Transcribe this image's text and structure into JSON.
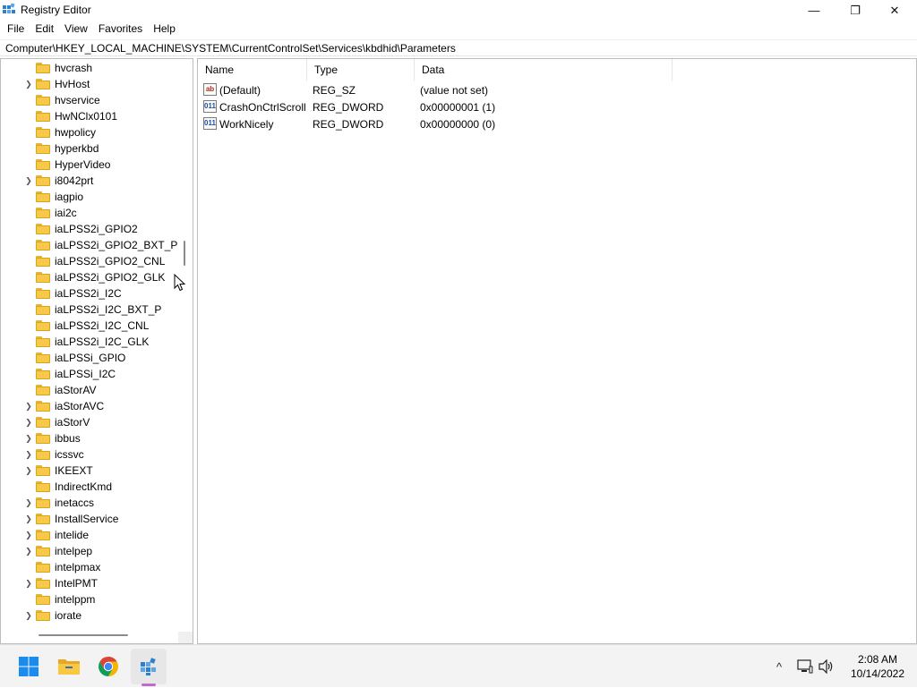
{
  "window": {
    "title": "Registry Editor",
    "minimize_glyph": "—",
    "maximize_glyph": "❐",
    "close_glyph": "✕"
  },
  "menu": [
    "File",
    "Edit",
    "View",
    "Favorites",
    "Help"
  ],
  "address": "Computer\\HKEY_LOCAL_MACHINE\\SYSTEM\\CurrentControlSet\\Services\\kbdhid\\Parameters",
  "tree": {
    "items": [
      {
        "label": "hvcrash",
        "expandable": false
      },
      {
        "label": "HvHost",
        "expandable": true
      },
      {
        "label": "hvservice",
        "expandable": false
      },
      {
        "label": "HwNClx0101",
        "expandable": false
      },
      {
        "label": "hwpolicy",
        "expandable": false
      },
      {
        "label": "hyperkbd",
        "expandable": false
      },
      {
        "label": "HyperVideo",
        "expandable": false
      },
      {
        "label": "i8042prt",
        "expandable": true
      },
      {
        "label": "iagpio",
        "expandable": false
      },
      {
        "label": "iai2c",
        "expandable": false
      },
      {
        "label": "iaLPSS2i_GPIO2",
        "expandable": false
      },
      {
        "label": "iaLPSS2i_GPIO2_BXT_P",
        "expandable": false
      },
      {
        "label": "iaLPSS2i_GPIO2_CNL",
        "expandable": false
      },
      {
        "label": "iaLPSS2i_GPIO2_GLK",
        "expandable": false
      },
      {
        "label": "iaLPSS2i_I2C",
        "expandable": false
      },
      {
        "label": "iaLPSS2i_I2C_BXT_P",
        "expandable": false
      },
      {
        "label": "iaLPSS2i_I2C_CNL",
        "expandable": false
      },
      {
        "label": "iaLPSS2i_I2C_GLK",
        "expandable": false
      },
      {
        "label": "iaLPSSi_GPIO",
        "expandable": false
      },
      {
        "label": "iaLPSSi_I2C",
        "expandable": false
      },
      {
        "label": "iaStorAV",
        "expandable": false
      },
      {
        "label": "iaStorAVC",
        "expandable": true
      },
      {
        "label": "iaStorV",
        "expandable": true
      },
      {
        "label": "ibbus",
        "expandable": true
      },
      {
        "label": "icssvc",
        "expandable": true
      },
      {
        "label": "IKEEXT",
        "expandable": true
      },
      {
        "label": "IndirectKmd",
        "expandable": false
      },
      {
        "label": "inetaccs",
        "expandable": true
      },
      {
        "label": "InstallService",
        "expandable": true
      },
      {
        "label": "intelide",
        "expandable": true
      },
      {
        "label": "intelpep",
        "expandable": true
      },
      {
        "label": "intelpmax",
        "expandable": false
      },
      {
        "label": "IntelPMT",
        "expandable": true
      },
      {
        "label": "intelppm",
        "expandable": false
      },
      {
        "label": "iorate",
        "expandable": true
      }
    ]
  },
  "values": {
    "columns": {
      "name": "Name",
      "type": "Type",
      "data": "Data"
    },
    "rows": [
      {
        "name": "(Default)",
        "type": "REG_SZ",
        "data": "(value not set)",
        "icon": "string-value-icon",
        "glyph": "ab"
      },
      {
        "name": "CrashOnCtrlScroll",
        "type": "REG_DWORD",
        "data": "0x00000001 (1)",
        "icon": "binary-value-icon",
        "glyph": "011"
      },
      {
        "name": "WorkNicely",
        "type": "REG_DWORD",
        "data": "0x00000000 (0)",
        "icon": "binary-value-icon",
        "glyph": "011"
      }
    ]
  },
  "taskbar": {
    "apps": [
      {
        "name": "start-button",
        "icon": "windows-logo-icon"
      },
      {
        "name": "file-explorer-button",
        "icon": "folder-icon"
      },
      {
        "name": "chrome-button",
        "icon": "chrome-icon"
      },
      {
        "name": "registry-editor-button",
        "icon": "regedit-icon",
        "active": true
      }
    ],
    "tray": {
      "chevron": "^",
      "network": "🖧",
      "volume": "🔊"
    },
    "clock": {
      "time": "2:08 AM",
      "date": "10/14/2022"
    }
  }
}
